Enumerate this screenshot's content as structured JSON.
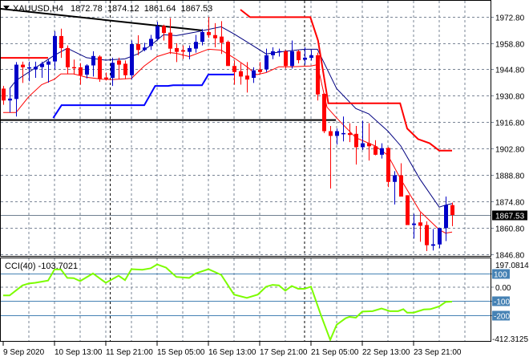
{
  "header": {
    "symbol": "XAUUSD,H4",
    "open": "1872.78",
    "high": "1874.12",
    "low": "1861.64",
    "close": "1867.53"
  },
  "colors": {
    "bull": "#0000c8",
    "bear": "#ff0000",
    "upper_band": "#000080",
    "lower_band": "#ff0000",
    "stop_up": "#0000ff",
    "stop_down": "#ff0000",
    "cci": "#7cfc00",
    "level": "#4682b4",
    "grid": "#7a8596"
  },
  "chart_data": {
    "type": "candlestick",
    "symbol": "XAUUSD",
    "timeframe": "H4",
    "price_axis": {
      "ticks": [
        "1972.80",
        "1958.80",
        "1944.80",
        "1930.80",
        "1916.80",
        "1902.80",
        "1888.80",
        "1874.80",
        "1860.80",
        "1846.80"
      ],
      "range": [
        1846.8,
        1972.8
      ]
    },
    "current_price": "1867.53",
    "time_labels": [
      {
        "index": 0,
        "label": "9 Sep 2020"
      },
      {
        "index": 8,
        "label": "10 Sep 13:00"
      },
      {
        "index": 16,
        "label": "11 Sep 21:00"
      },
      {
        "index": 24,
        "label": "15 Sep 05:00"
      },
      {
        "index": 32,
        "label": "16 Sep 13:00"
      },
      {
        "index": 40,
        "label": "17 Sep 21:00"
      },
      {
        "index": 48,
        "label": "21 Sep 05:00"
      },
      {
        "index": 56,
        "label": "22 Sep 13:00"
      },
      {
        "index": 64,
        "label": "23 Sep 21:00"
      }
    ],
    "ohlc": [
      [
        1934.6,
        1936,
        1926,
        1928.3
      ],
      [
        1928.3,
        1934.6,
        1921.9,
        1929.3
      ],
      [
        1929.1,
        1948.7,
        1919.8,
        1947.3
      ],
      [
        1947.3,
        1948.9,
        1937.6,
        1945.9
      ],
      [
        1945.5,
        1948.9,
        1938.5,
        1945.9
      ],
      [
        1944.8,
        1948.9,
        1940.3,
        1946.2
      ],
      [
        1946,
        1948.9,
        1940.3,
        1947.8
      ],
      [
        1947.3,
        1949.9,
        1937.8,
        1949
      ],
      [
        1949,
        1965,
        1944.8,
        1962.5
      ],
      [
        1962.5,
        1966.4,
        1950.9,
        1956.1
      ],
      [
        1956.1,
        1957.5,
        1942.4,
        1945.9
      ],
      [
        1946,
        1950,
        1942,
        1945.5
      ],
      [
        1945.9,
        1948.1,
        1936.7,
        1941.7
      ],
      [
        1942,
        1947.5,
        1940,
        1946.9
      ],
      [
        1946.9,
        1954.4,
        1941,
        1951.9
      ],
      [
        1951.6,
        1952.3,
        1938.2,
        1939.6
      ],
      [
        1940.5,
        1943.1,
        1938.9,
        1939.6
      ],
      [
        1940.3,
        1951,
        1936,
        1948.3
      ],
      [
        1949.5,
        1951,
        1939.6,
        1947.3
      ],
      [
        1947.8,
        1949.5,
        1939.6,
        1941.7
      ],
      [
        1941.7,
        1960.1,
        1939.6,
        1958.2
      ],
      [
        1958.2,
        1962.9,
        1952.3,
        1955.1
      ],
      [
        1955.1,
        1958.9,
        1954.4,
        1956.4
      ],
      [
        1957.2,
        1963.1,
        1955.1,
        1961
      ],
      [
        1961,
        1970,
        1960.1,
        1967.8
      ],
      [
        1967.8,
        1968.5,
        1960.1,
        1964.1
      ],
      [
        1964.3,
        1972,
        1953,
        1955.8
      ],
      [
        1956.1,
        1958.7,
        1948.7,
        1954.1
      ],
      [
        1955,
        1957.5,
        1950.4,
        1954.2
      ],
      [
        1954.1,
        1957.5,
        1950.1,
        1956.1
      ],
      [
        1955.8,
        1963.1,
        1953.7,
        1959.4
      ],
      [
        1959.4,
        1966.2,
        1957.5,
        1964.6
      ],
      [
        1964.6,
        1972.5,
        1961.5,
        1963
      ],
      [
        1963,
        1969.3,
        1956.5,
        1961.3
      ],
      [
        1962.2,
        1970.4,
        1953,
        1958.9
      ],
      [
        1959.4,
        1960.1,
        1946.6,
        1946.6
      ],
      [
        1946.6,
        1949.5,
        1936.7,
        1943.4
      ],
      [
        1943.8,
        1948.1,
        1936.7,
        1941
      ],
      [
        1941.5,
        1948.7,
        1932.5,
        1939.4
      ],
      [
        1940.3,
        1945.9,
        1937.6,
        1944.3
      ],
      [
        1944.7,
        1948.7,
        1942.4,
        1943.4
      ],
      [
        1944.8,
        1955.8,
        1943.4,
        1952.3
      ],
      [
        1952.3,
        1956.5,
        1950.2,
        1954.4
      ],
      [
        1954,
        1955.8,
        1951.6,
        1954.5
      ],
      [
        1954.4,
        1955.1,
        1945.2,
        1946.6
      ],
      [
        1946.6,
        1960.1,
        1945.2,
        1954.4
      ],
      [
        1954.4,
        1955.1,
        1948,
        1949.7
      ],
      [
        1949.9,
        1956.5,
        1947.3,
        1951
      ],
      [
        1950.9,
        1955.1,
        1949.5,
        1952.3
      ],
      [
        1952.3,
        1953.7,
        1928.3,
        1931.5
      ],
      [
        1931.8,
        1932.2,
        1911,
        1912
      ],
      [
        1912,
        1914.8,
        1881.6,
        1909.5
      ],
      [
        1909.5,
        1913.4,
        1904.9,
        1912
      ],
      [
        1910.5,
        1919.8,
        1906.6,
        1911
      ],
      [
        1911,
        1916.2,
        1906.2,
        1910
      ],
      [
        1910.6,
        1914.8,
        1894.3,
        1903.5
      ],
      [
        1903.5,
        1917.6,
        1902,
        1905.6
      ],
      [
        1905.6,
        1916.2,
        1896.4,
        1904
      ],
      [
        1904,
        1907.2,
        1899.2,
        1899.5
      ],
      [
        1899.5,
        1905.6,
        1897.5,
        1903
      ],
      [
        1903.1,
        1903.5,
        1882.3,
        1885.1
      ],
      [
        1885.1,
        1890.8,
        1873.1,
        1888.6
      ],
      [
        1888.6,
        1895,
        1877.3,
        1877.3
      ],
      [
        1878,
        1878,
        1862.2,
        1862.2
      ],
      [
        1862.2,
        1868.1,
        1855.1,
        1863
      ],
      [
        1863.6,
        1868.8,
        1853.3,
        1861.8
      ],
      [
        1862.2,
        1864.2,
        1848.4,
        1851.5
      ],
      [
        1851.2,
        1860.1,
        1848.7,
        1852
      ],
      [
        1851.9,
        1860.6,
        1849.9,
        1860.6
      ],
      [
        1860.6,
        1877.3,
        1853.7,
        1872.8
      ],
      [
        1872.78,
        1874.12,
        1861.64,
        1867.53
      ]
    ],
    "upper_band": [
      [
        1,
        1934.6
      ],
      [
        2,
        1938.9
      ],
      [
        8,
        1952.3
      ],
      [
        10,
        1956
      ],
      [
        13,
        1951
      ],
      [
        16,
        1949.7
      ],
      [
        19,
        1950.4
      ],
      [
        21,
        1953
      ],
      [
        23,
        1957.5
      ],
      [
        25,
        1963.2
      ],
      [
        27,
        1962.7
      ],
      [
        30,
        1964.6
      ],
      [
        34,
        1967.4
      ],
      [
        36,
        1963.6
      ],
      [
        38,
        1959.4
      ],
      [
        41,
        1953
      ],
      [
        44,
        1954.4
      ],
      [
        47,
        1955.5
      ],
      [
        49,
        1955.5
      ],
      [
        52,
        1934.6
      ],
      [
        55,
        1924
      ],
      [
        57,
        1921.2
      ],
      [
        60,
        1912
      ],
      [
        62,
        1904.2
      ],
      [
        65,
        1886.5
      ],
      [
        68,
        1871.7
      ],
      [
        69,
        1872.8
      ],
      [
        70,
        1873.6
      ]
    ],
    "lower_band": [
      [
        0,
        1921.9
      ],
      [
        2,
        1921.9
      ],
      [
        4,
        1930.4
      ],
      [
        6,
        1936.7
      ],
      [
        8,
        1939.6
      ],
      [
        9,
        1942.4
      ],
      [
        11,
        1942.4
      ],
      [
        13,
        1940.6
      ],
      [
        15.5,
        1939.6
      ],
      [
        17,
        1939.4
      ],
      [
        20,
        1940
      ],
      [
        22,
        1946.6
      ],
      [
        24,
        1951.6
      ],
      [
        26,
        1953.7
      ],
      [
        27,
        1953.3
      ],
      [
        29,
        1951.6
      ],
      [
        32,
        1955.5
      ],
      [
        34,
        1955
      ],
      [
        36,
        1950.9
      ],
      [
        38,
        1946.2
      ],
      [
        39.5,
        1942
      ],
      [
        41,
        1943.1
      ],
      [
        43,
        1946.2
      ],
      [
        45,
        1946.2
      ],
      [
        48,
        1946.6
      ],
      [
        49,
        1947.3
      ],
      [
        50.5,
        1924.7
      ],
      [
        52,
        1919
      ],
      [
        55,
        1908.5
      ],
      [
        58,
        1904.2
      ],
      [
        60,
        1899.2
      ],
      [
        62,
        1886.5
      ],
      [
        65,
        1869.5
      ],
      [
        68,
        1859.7
      ],
      [
        69,
        1857.9
      ],
      [
        70,
        1858.5
      ]
    ],
    "stop_down_segments": [
      [
        [
          -0.5,
          1950.9
        ],
        [
          7,
          1950.9
        ]
      ],
      [
        [
          37,
          1976.5
        ],
        [
          38.5,
          1972.5
        ],
        [
          47.9,
          1972.5
        ],
        [
          49.1,
          1960.1
        ],
        [
          50.7,
          1926.8
        ],
        [
          61.9,
          1926.8
        ],
        [
          63,
          1913.4
        ],
        [
          64.7,
          1907.8
        ],
        [
          66.5,
          1905.6
        ],
        [
          68,
          1901.7
        ],
        [
          70,
          1901.7
        ]
      ]
    ],
    "stop_up": [
      [
        7.8,
        1919
      ],
      [
        9.1,
        1925.8
      ],
      [
        22,
        1925.8
      ],
      [
        23.7,
        1936
      ],
      [
        25.7,
        1936
      ],
      [
        26.5,
        1936.4
      ],
      [
        31,
        1936.4
      ],
      [
        32,
        1942.1
      ],
      [
        36,
        1942.1
      ]
    ],
    "trendline": [
      [
        -0.5,
        1977
      ],
      [
        31,
        1965.5
      ]
    ],
    "horizontal_line": {
      "price": 1917.9,
      "from": -0.5,
      "to": 51.9
    },
    "cci_panel": {
      "label": "CCI(40) -103.7021",
      "period": 40,
      "value": -103.7021,
      "max_label": "197.0814",
      "min_label": "-412.3125",
      "levels": [
        {
          "value": 100,
          "label": "100"
        },
        {
          "value": -100,
          "label": "-100"
        },
        {
          "value": -200,
          "label": "-200"
        }
      ],
      "zero_label": "0.00",
      "range": [
        -412.3125,
        197.0814
      ],
      "values": [
        [
          0,
          -59
        ],
        [
          1,
          -59
        ],
        [
          3,
          13
        ],
        [
          4,
          27
        ],
        [
          5,
          32
        ],
        [
          7,
          48
        ],
        [
          8,
          128
        ],
        [
          9,
          128
        ],
        [
          10,
          67
        ],
        [
          11,
          65
        ],
        [
          12,
          44
        ],
        [
          14,
          99
        ],
        [
          16,
          32
        ],
        [
          18,
          83
        ],
        [
          19,
          51
        ],
        [
          20,
          130
        ],
        [
          21.7,
          126
        ],
        [
          23,
          136
        ],
        [
          24,
          164
        ],
        [
          25.4,
          141
        ],
        [
          27,
          74
        ],
        [
          29,
          67
        ],
        [
          30,
          99
        ],
        [
          32,
          130
        ],
        [
          34,
          89
        ],
        [
          36,
          -53
        ],
        [
          38,
          -77
        ],
        [
          39.7,
          -53
        ],
        [
          41,
          4
        ],
        [
          42,
          17
        ],
        [
          43,
          13
        ],
        [
          44,
          -25
        ],
        [
          45,
          9
        ],
        [
          46,
          -11
        ],
        [
          47,
          -11
        ],
        [
          48,
          4
        ],
        [
          49.5,
          -194
        ],
        [
          51,
          -379
        ],
        [
          52,
          -270
        ],
        [
          53.4,
          -223
        ],
        [
          54,
          -213
        ],
        [
          55,
          -219
        ],
        [
          56,
          -175
        ],
        [
          57.6,
          -172
        ],
        [
          59,
          -153
        ],
        [
          60.3,
          -172
        ],
        [
          61.6,
          -172
        ],
        [
          62.4,
          -158
        ],
        [
          63,
          -183
        ],
        [
          64,
          -183
        ],
        [
          65.6,
          -160
        ],
        [
          66.6,
          -158
        ],
        [
          68,
          -138
        ],
        [
          69,
          -106
        ],
        [
          70,
          -103.7
        ]
      ]
    }
  }
}
